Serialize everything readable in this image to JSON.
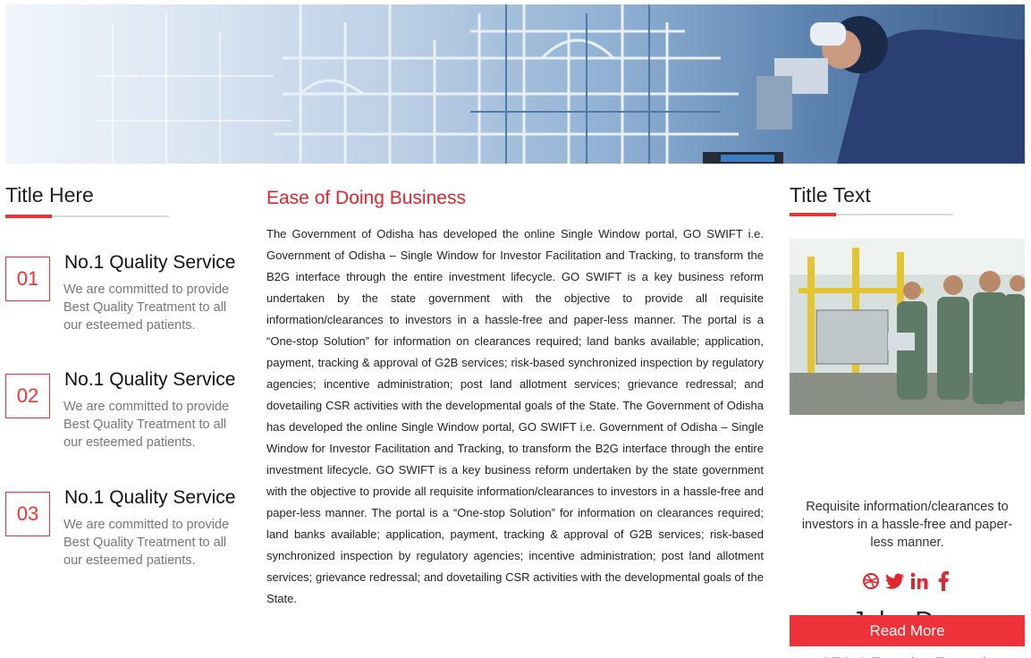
{
  "left": {
    "title": "Title Here",
    "features": [
      {
        "num": "01",
        "title": "No.1 Quality Service",
        "desc": "We are committed to provide Best Quality Treatment to all our esteemed patients."
      },
      {
        "num": "02",
        "title": "No.1 Quality Service",
        "desc": "We are committed to provide Best Quality Treatment to all our esteemed patients."
      },
      {
        "num": "03",
        "title": "No.1 Quality Service",
        "desc": "We are committed to provide Best Quality Treatment to all our esteemed patients."
      }
    ]
  },
  "middle": {
    "title": "Ease of Doing Business",
    "body": "The Government of Odisha has developed the online Single Window portal, GO SWIFT i.e. Government of Odisha – Single Window for Investor Facilitation and Tracking, to transform the B2G interface through the entire investment lifecycle. GO SWIFT is a key business reform undertaken by the state government with the objective to provide all requisite information/clearances to investors in a hassle-free and paper-less manner. The portal is a “One-stop Solution” for information on clearances required; land banks available; application, payment, tracking & approval of G2B services; risk-based synchronized inspection by regulatory agencies; incentive administration; post land allotment services; grievance redressal; and dovetailing CSR activities with the developmental goals of the State. The Government of Odisha has developed the online Single Window portal, GO SWIFT i.e. Government of Odisha – Single Window for Investor Facilitation and Tracking, to transform the B2G interface through the entire investment lifecycle. GO SWIFT is a key business reform undertaken by the state government with the objective to provide all requisite information/clearances to investors in a hassle-free and paper-less manner. The portal is a “One-stop Solution” for information on clearances required; land banks available; application, payment, tracking & approval of G2B services; risk-based synchronized inspection by regulatory agencies; incentive administration; post land allotment services; grievance redressal; and dovetailing CSR activities with the developmental goals of the State."
  },
  "right": {
    "title": "Title Text",
    "name": "John Doe",
    "role": "CEO & Founder, Example",
    "quote": "Requisite information/clearances to investors in a hassle-free and paper-less manner.",
    "socials": [
      {
        "icon": "dribbble-icon"
      },
      {
        "icon": "twitter-icon"
      },
      {
        "icon": "linkedin-icon"
      },
      {
        "icon": "facebook-icon"
      }
    ],
    "button_label": "Read More"
  },
  "colors": {
    "accent": "#e8333b",
    "button": "#ee3239",
    "muted_text": "#777777"
  }
}
